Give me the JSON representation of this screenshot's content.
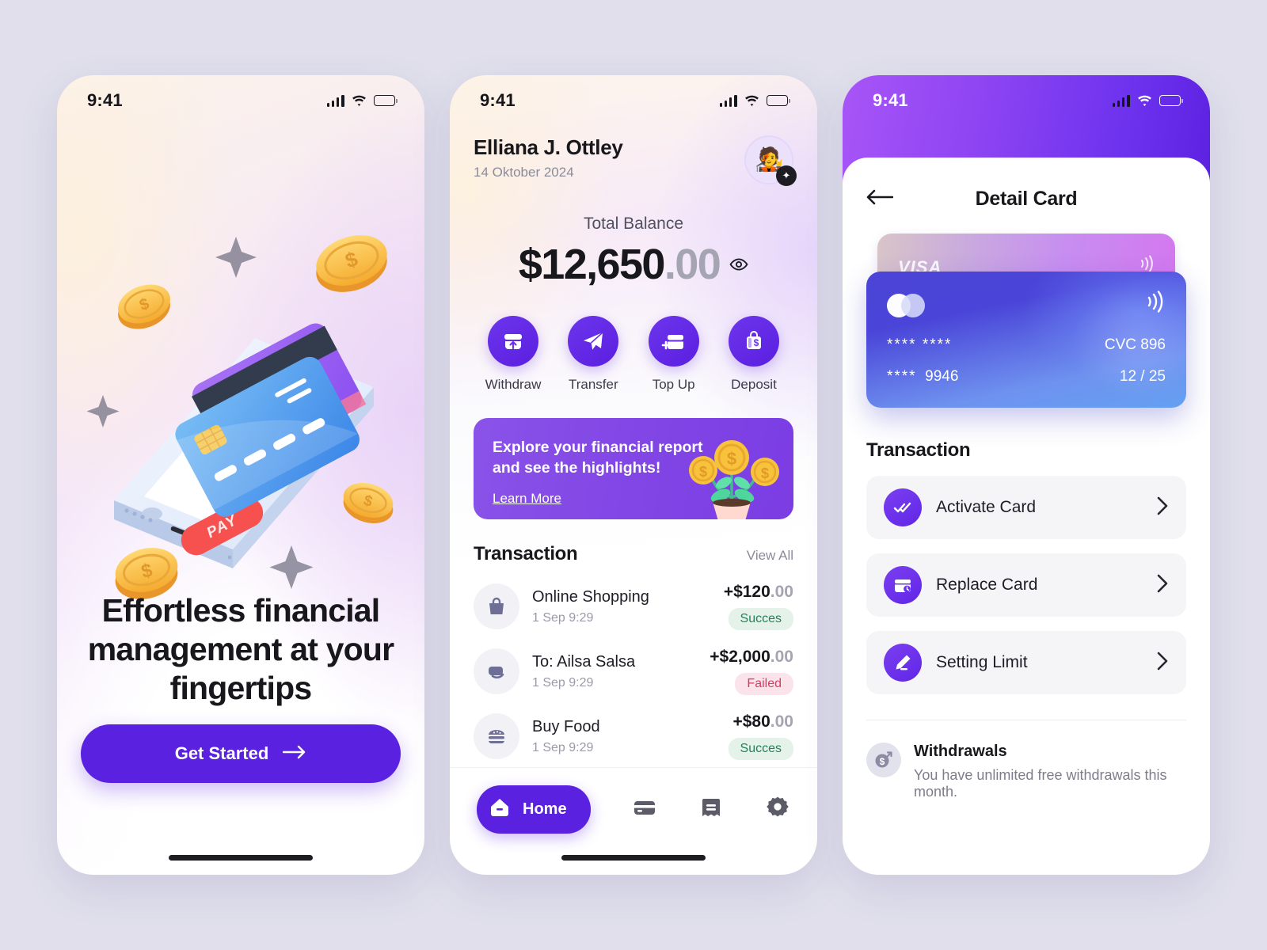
{
  "statusbar": {
    "time": "9:41",
    "signal_icon": "cellular-signal-icon",
    "wifi_icon": "wifi-icon",
    "battery_icon": "battery-icon"
  },
  "screen_onboarding": {
    "illustration": "phone-with-credit-cards-illustration",
    "pay_button_label": "PAY",
    "headline": "Effortless financial management at your fingertips",
    "pagination": {
      "active_index": 0,
      "count": 3
    },
    "cta_label": "Get Started",
    "cta_icon": "arrow-right-icon",
    "cta_color": "#5B21E0"
  },
  "screen_home": {
    "user_name": "Elliana J. Ottley",
    "date": "14 Oktober 2024",
    "avatar_icon": "user-avatar",
    "avatar_badge_icon": "sparkle-icon",
    "balance_label": "Total Balance",
    "balance_main": "$12,650",
    "balance_cents": ".00",
    "eye_icon": "eye-icon",
    "actions": [
      {
        "label": "Withdraw",
        "icon": "withdraw-icon"
      },
      {
        "label": "Transfer",
        "icon": "send-icon"
      },
      {
        "label": "Top Up",
        "icon": "top-up-card-icon"
      },
      {
        "label": "Deposit",
        "icon": "deposit-money-icon"
      }
    ],
    "banner": {
      "title_line1": "Explore your financial report",
      "title_line2": "and see the highlights!",
      "link_label": "Learn More",
      "illustration": "money-plant-illustration",
      "color": "#8348E6"
    },
    "transaction_section": {
      "title": "Transaction",
      "view_all_label": "View All"
    },
    "transactions": [
      {
        "title": "Online Shopping",
        "time": "1 Sep 9:29",
        "amount": "+$120",
        "cents": ".00",
        "status": "Succes",
        "status_type": "ok",
        "icon": "shopping-bag-icon"
      },
      {
        "title": "To: Ailsa Salsa",
        "time": "1 Sep 9:29",
        "amount": "+$2,000",
        "cents": ".00",
        "status": "Failed",
        "status_type": "fail",
        "icon": "wallet-icon"
      },
      {
        "title": "Buy Food",
        "time": "1 Sep 9:29",
        "amount": "+$80",
        "cents": ".00",
        "status": "Succes",
        "status_type": "ok",
        "icon": "burger-icon"
      }
    ],
    "tabbar": [
      {
        "label": "Home",
        "icon": "home-icon",
        "active": true
      },
      {
        "label": "",
        "icon": "card-icon",
        "active": false
      },
      {
        "label": "",
        "icon": "bill-icon",
        "active": false
      },
      {
        "label": "",
        "icon": "gear-icon",
        "active": false
      }
    ]
  },
  "screen_card_detail": {
    "back_icon": "arrow-left-icon",
    "title": "Detail Card",
    "header_gradient": [
      "#A855F7",
      "#5B21E0"
    ],
    "card_back": {
      "brand": "VISA",
      "nfc_icon": "contactless-icon"
    },
    "card_front": {
      "brand_icon": "mastercard-icon",
      "nfc_icon": "contactless-icon",
      "number_group_1": "**** ****",
      "number_group_2": "****",
      "number_last4": "9946",
      "cvc_label": "CVC 896",
      "expiry": "12 / 25"
    },
    "section_title": "Transaction",
    "menu": [
      {
        "label": "Activate Card",
        "icon": "double-check-icon",
        "chevron": "chevron-right-icon"
      },
      {
        "label": "Replace Card",
        "icon": "card-replace-icon",
        "chevron": "chevron-right-icon"
      },
      {
        "label": "Setting Limit",
        "icon": "pencil-edit-icon",
        "chevron": "chevron-right-icon"
      }
    ],
    "withdrawals": {
      "icon": "dollar-arrow-icon",
      "title": "Withdrawals",
      "subtitle": "You have unlimited free withdrawals this month."
    }
  }
}
